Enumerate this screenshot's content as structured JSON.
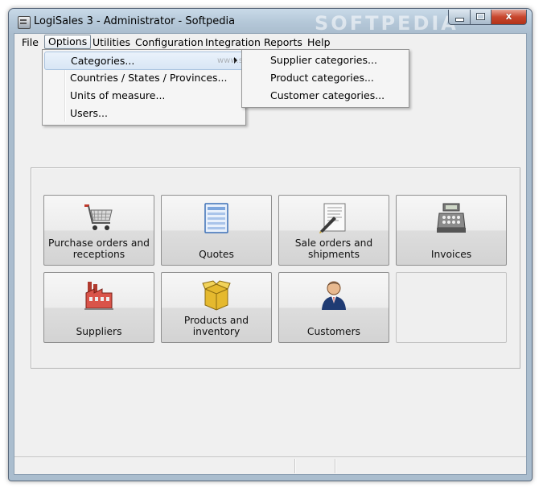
{
  "window": {
    "title": "LogiSales 3 - Administrator - Softpedia",
    "watermark": "SOFTPEDIA",
    "controls": {
      "minimize": "",
      "maximize": "",
      "close": "x"
    }
  },
  "menubar": {
    "items": [
      "File",
      "Options",
      "Utilities",
      "Configuration",
      "Integration",
      "Reports",
      "Help"
    ],
    "active": "Options"
  },
  "options_menu": {
    "items": [
      "Categories...",
      "Countries / States / Provinces...",
      "Units of measure...",
      "Users..."
    ],
    "highlighted": "Categories..."
  },
  "categories_submenu": {
    "items": [
      "Supplier categories...",
      "Product categories...",
      "Customer categories..."
    ]
  },
  "watermark_small": "www.softpedia.com",
  "tiles": [
    {
      "label": "Purchase orders and receptions",
      "icon": "shopping-cart-icon"
    },
    {
      "label": "Quotes",
      "icon": "quote-document-icon"
    },
    {
      "label": "Sale orders and shipments",
      "icon": "contract-pen-icon"
    },
    {
      "label": "Invoices",
      "icon": "cash-register-icon"
    },
    {
      "label": "Suppliers",
      "icon": "factory-icon"
    },
    {
      "label": "Products and inventory",
      "icon": "box-icon"
    },
    {
      "label": "Customers",
      "icon": "customer-person-icon"
    }
  ],
  "colors": {
    "title_gradient_top": "#c9dae8",
    "close_button": "#c8462d",
    "menu_highlight": "#d8e6f5"
  }
}
